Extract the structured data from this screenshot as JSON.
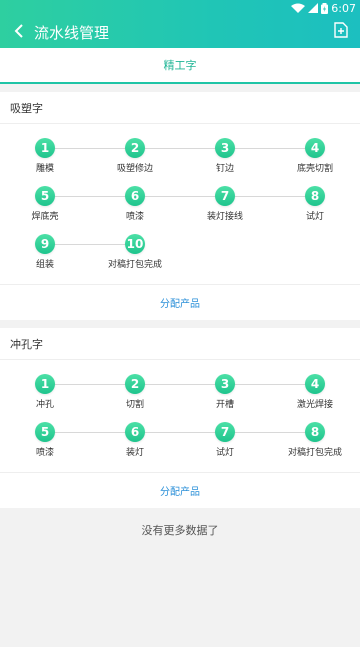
{
  "status": {
    "time": "6:07"
  },
  "header": {
    "title": "流水线管理"
  },
  "tabs": [
    {
      "label": "精工字"
    }
  ],
  "sections": [
    {
      "title": "吸塑字",
      "steps": [
        {
          "num": "1",
          "label": "雕模"
        },
        {
          "num": "2",
          "label": "吸塑修边"
        },
        {
          "num": "3",
          "label": "钉边"
        },
        {
          "num": "4",
          "label": "底壳切割"
        },
        {
          "num": "5",
          "label": "焊底壳"
        },
        {
          "num": "6",
          "label": "喷漆"
        },
        {
          "num": "7",
          "label": "装灯接线"
        },
        {
          "num": "8",
          "label": "试灯"
        },
        {
          "num": "9",
          "label": "组装"
        },
        {
          "num": "10",
          "label": "对稿打包完成"
        }
      ],
      "assign_label": "分配产品"
    },
    {
      "title": "冲孔字",
      "steps": [
        {
          "num": "1",
          "label": "冲孔"
        },
        {
          "num": "2",
          "label": "切割"
        },
        {
          "num": "3",
          "label": "开槽"
        },
        {
          "num": "4",
          "label": "激光焊接"
        },
        {
          "num": "5",
          "label": "喷漆"
        },
        {
          "num": "6",
          "label": "装灯"
        },
        {
          "num": "7",
          "label": "试灯"
        },
        {
          "num": "8",
          "label": "对稿打包完成"
        }
      ],
      "assign_label": "分配产品"
    }
  ],
  "footer": {
    "no_more": "没有更多数据了"
  },
  "colors": {
    "accent": "#1fc4a6",
    "step_dot": "#2ccf93",
    "link": "#2a8fd8"
  }
}
